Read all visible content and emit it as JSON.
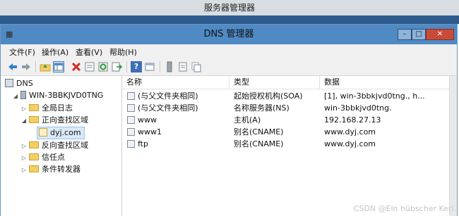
{
  "background_window": {
    "title": "服务器管理器"
  },
  "window": {
    "title": "DNS 管理器",
    "min_glyph": "–",
    "max_glyph": "□",
    "close_glyph": "✕"
  },
  "menu": [
    "文件(F)",
    "操作(A)",
    "查看(V)",
    "帮助(H)"
  ],
  "toolbar": {
    "icons": [
      "back-icon",
      "forward-icon",
      "up-folder-icon",
      "show-hide-tree-icon",
      "delete-icon",
      "properties-icon",
      "refresh-icon",
      "export-icon",
      "help-icon",
      "view-icon",
      "server-icon",
      "list-icon",
      "copy-icon"
    ]
  },
  "tree": {
    "root": "DNS",
    "server": "WIN-3BBKJVD0TNG",
    "global_logs": "全局日志",
    "forward_zones": "正向查找区域",
    "zone": "dyj.com",
    "reverse_zones": "反向查找区域",
    "trust_points": "信任点",
    "conditional_forwarders": "条件转发器"
  },
  "table": {
    "columns": [
      "名称",
      "类型",
      "数据"
    ],
    "rows": [
      [
        "(与父文件夹相同)",
        "起始授权机构(SOA)",
        "[1], win-3bbkjvd0tng., h..."
      ],
      [
        "(与父文件夹相同)",
        "名称服务器(NS)",
        "win-3bbkjvd0tng."
      ],
      [
        "www",
        "主机(A)",
        "192.168.27.13"
      ],
      [
        "www1",
        "别名(CNAME)",
        "www.dyj.com"
      ],
      [
        "ftp",
        "别名(CNAME)",
        "www.dyj.com"
      ]
    ]
  },
  "watermark": "CSDN @Ein hübscher Kerl.",
  "colors": {
    "titlebar": "#4f8ac5",
    "selection": "#dbe9f8",
    "folder": "#f3cf62",
    "close": "#c84b3a"
  }
}
